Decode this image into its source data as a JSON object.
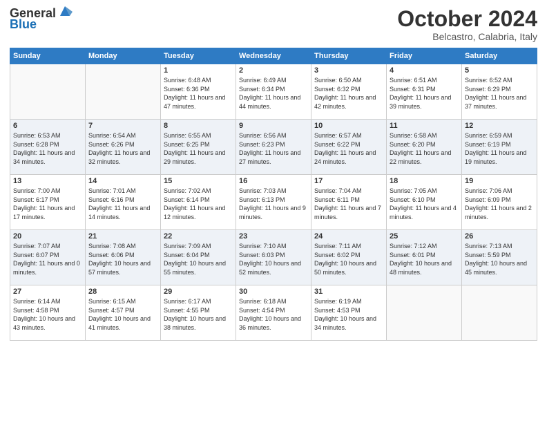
{
  "logo": {
    "text_general": "General",
    "text_blue": "Blue"
  },
  "header": {
    "month": "October 2024",
    "location": "Belcastro, Calabria, Italy"
  },
  "weekdays": [
    "Sunday",
    "Monday",
    "Tuesday",
    "Wednesday",
    "Thursday",
    "Friday",
    "Saturday"
  ],
  "weeks": [
    [
      {
        "day": "",
        "sunrise": "",
        "sunset": "",
        "daylight": "",
        "empty": true
      },
      {
        "day": "",
        "sunrise": "",
        "sunset": "",
        "daylight": "",
        "empty": true
      },
      {
        "day": "1",
        "sunrise": "Sunrise: 6:48 AM",
        "sunset": "Sunset: 6:36 PM",
        "daylight": "Daylight: 11 hours and 47 minutes.",
        "empty": false
      },
      {
        "day": "2",
        "sunrise": "Sunrise: 6:49 AM",
        "sunset": "Sunset: 6:34 PM",
        "daylight": "Daylight: 11 hours and 44 minutes.",
        "empty": false
      },
      {
        "day": "3",
        "sunrise": "Sunrise: 6:50 AM",
        "sunset": "Sunset: 6:32 PM",
        "daylight": "Daylight: 11 hours and 42 minutes.",
        "empty": false
      },
      {
        "day": "4",
        "sunrise": "Sunrise: 6:51 AM",
        "sunset": "Sunset: 6:31 PM",
        "daylight": "Daylight: 11 hours and 39 minutes.",
        "empty": false
      },
      {
        "day": "5",
        "sunrise": "Sunrise: 6:52 AM",
        "sunset": "Sunset: 6:29 PM",
        "daylight": "Daylight: 11 hours and 37 minutes.",
        "empty": false
      }
    ],
    [
      {
        "day": "6",
        "sunrise": "Sunrise: 6:53 AM",
        "sunset": "Sunset: 6:28 PM",
        "daylight": "Daylight: 11 hours and 34 minutes.",
        "empty": false
      },
      {
        "day": "7",
        "sunrise": "Sunrise: 6:54 AM",
        "sunset": "Sunset: 6:26 PM",
        "daylight": "Daylight: 11 hours and 32 minutes.",
        "empty": false
      },
      {
        "day": "8",
        "sunrise": "Sunrise: 6:55 AM",
        "sunset": "Sunset: 6:25 PM",
        "daylight": "Daylight: 11 hours and 29 minutes.",
        "empty": false
      },
      {
        "day": "9",
        "sunrise": "Sunrise: 6:56 AM",
        "sunset": "Sunset: 6:23 PM",
        "daylight": "Daylight: 11 hours and 27 minutes.",
        "empty": false
      },
      {
        "day": "10",
        "sunrise": "Sunrise: 6:57 AM",
        "sunset": "Sunset: 6:22 PM",
        "daylight": "Daylight: 11 hours and 24 minutes.",
        "empty": false
      },
      {
        "day": "11",
        "sunrise": "Sunrise: 6:58 AM",
        "sunset": "Sunset: 6:20 PM",
        "daylight": "Daylight: 11 hours and 22 minutes.",
        "empty": false
      },
      {
        "day": "12",
        "sunrise": "Sunrise: 6:59 AM",
        "sunset": "Sunset: 6:19 PM",
        "daylight": "Daylight: 11 hours and 19 minutes.",
        "empty": false
      }
    ],
    [
      {
        "day": "13",
        "sunrise": "Sunrise: 7:00 AM",
        "sunset": "Sunset: 6:17 PM",
        "daylight": "Daylight: 11 hours and 17 minutes.",
        "empty": false
      },
      {
        "day": "14",
        "sunrise": "Sunrise: 7:01 AM",
        "sunset": "Sunset: 6:16 PM",
        "daylight": "Daylight: 11 hours and 14 minutes.",
        "empty": false
      },
      {
        "day": "15",
        "sunrise": "Sunrise: 7:02 AM",
        "sunset": "Sunset: 6:14 PM",
        "daylight": "Daylight: 11 hours and 12 minutes.",
        "empty": false
      },
      {
        "day": "16",
        "sunrise": "Sunrise: 7:03 AM",
        "sunset": "Sunset: 6:13 PM",
        "daylight": "Daylight: 11 hours and 9 minutes.",
        "empty": false
      },
      {
        "day": "17",
        "sunrise": "Sunrise: 7:04 AM",
        "sunset": "Sunset: 6:11 PM",
        "daylight": "Daylight: 11 hours and 7 minutes.",
        "empty": false
      },
      {
        "day": "18",
        "sunrise": "Sunrise: 7:05 AM",
        "sunset": "Sunset: 6:10 PM",
        "daylight": "Daylight: 11 hours and 4 minutes.",
        "empty": false
      },
      {
        "day": "19",
        "sunrise": "Sunrise: 7:06 AM",
        "sunset": "Sunset: 6:09 PM",
        "daylight": "Daylight: 11 hours and 2 minutes.",
        "empty": false
      }
    ],
    [
      {
        "day": "20",
        "sunrise": "Sunrise: 7:07 AM",
        "sunset": "Sunset: 6:07 PM",
        "daylight": "Daylight: 11 hours and 0 minutes.",
        "empty": false
      },
      {
        "day": "21",
        "sunrise": "Sunrise: 7:08 AM",
        "sunset": "Sunset: 6:06 PM",
        "daylight": "Daylight: 10 hours and 57 minutes.",
        "empty": false
      },
      {
        "day": "22",
        "sunrise": "Sunrise: 7:09 AM",
        "sunset": "Sunset: 6:04 PM",
        "daylight": "Daylight: 10 hours and 55 minutes.",
        "empty": false
      },
      {
        "day": "23",
        "sunrise": "Sunrise: 7:10 AM",
        "sunset": "Sunset: 6:03 PM",
        "daylight": "Daylight: 10 hours and 52 minutes.",
        "empty": false
      },
      {
        "day": "24",
        "sunrise": "Sunrise: 7:11 AM",
        "sunset": "Sunset: 6:02 PM",
        "daylight": "Daylight: 10 hours and 50 minutes.",
        "empty": false
      },
      {
        "day": "25",
        "sunrise": "Sunrise: 7:12 AM",
        "sunset": "Sunset: 6:01 PM",
        "daylight": "Daylight: 10 hours and 48 minutes.",
        "empty": false
      },
      {
        "day": "26",
        "sunrise": "Sunrise: 7:13 AM",
        "sunset": "Sunset: 5:59 PM",
        "daylight": "Daylight: 10 hours and 45 minutes.",
        "empty": false
      }
    ],
    [
      {
        "day": "27",
        "sunrise": "Sunrise: 6:14 AM",
        "sunset": "Sunset: 4:58 PM",
        "daylight": "Daylight: 10 hours and 43 minutes.",
        "empty": false
      },
      {
        "day": "28",
        "sunrise": "Sunrise: 6:15 AM",
        "sunset": "Sunset: 4:57 PM",
        "daylight": "Daylight: 10 hours and 41 minutes.",
        "empty": false
      },
      {
        "day": "29",
        "sunrise": "Sunrise: 6:17 AM",
        "sunset": "Sunset: 4:55 PM",
        "daylight": "Daylight: 10 hours and 38 minutes.",
        "empty": false
      },
      {
        "day": "30",
        "sunrise": "Sunrise: 6:18 AM",
        "sunset": "Sunset: 4:54 PM",
        "daylight": "Daylight: 10 hours and 36 minutes.",
        "empty": false
      },
      {
        "day": "31",
        "sunrise": "Sunrise: 6:19 AM",
        "sunset": "Sunset: 4:53 PM",
        "daylight": "Daylight: 10 hours and 34 minutes.",
        "empty": false
      },
      {
        "day": "",
        "sunrise": "",
        "sunset": "",
        "daylight": "",
        "empty": true
      },
      {
        "day": "",
        "sunrise": "",
        "sunset": "",
        "daylight": "",
        "empty": true
      }
    ]
  ]
}
